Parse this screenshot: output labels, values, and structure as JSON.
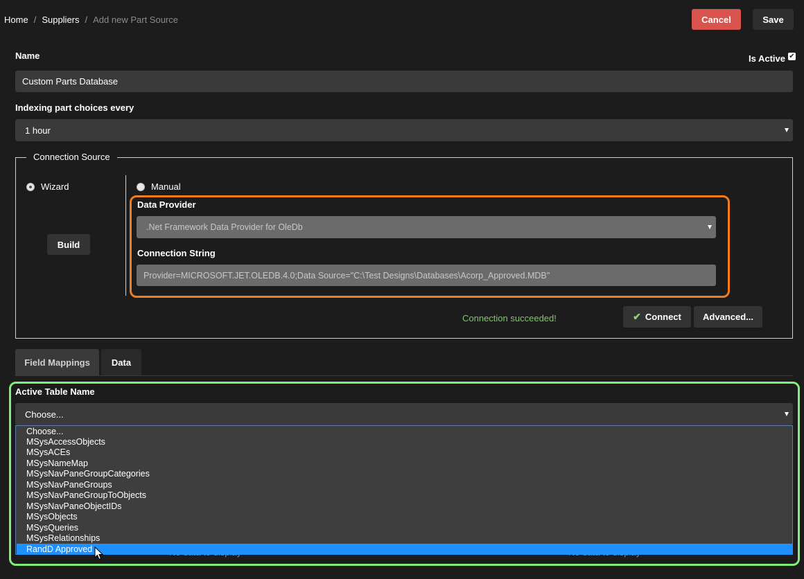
{
  "breadcrumb": {
    "home": "Home",
    "suppliers": "Suppliers",
    "separator": "/",
    "current": "Add new Part Source"
  },
  "header": {
    "cancel_label": "Cancel",
    "save_label": "Save"
  },
  "name": {
    "label": "Name",
    "value": "Custom Parts Database",
    "is_active_label": "Is Active",
    "is_active": true
  },
  "indexing": {
    "label": "Indexing part choices every",
    "value": "1 hour"
  },
  "connection": {
    "legend": "Connection Source",
    "wizard_label": "Wizard",
    "manual_label": "Manual",
    "selected_mode": "Wizard",
    "build_label": "Build",
    "provider_label": "Data Provider",
    "provider_value": ".Net Framework Data Provider for OleDb",
    "string_label": "Connection String",
    "string_value": "Provider=MICROSOFT.JET.OLEDB.4.0;Data Source=\"C:\\Test Designs\\Databases\\Acorp_Approved.MDB\"",
    "status": "Connection succeeded!",
    "connect_label": "Connect",
    "advanced_label": "Advanced..."
  },
  "tabs": [
    {
      "label": "Field Mappings"
    },
    {
      "label": "Data"
    }
  ],
  "table": {
    "label": "Active Table Name",
    "value": "Choose...",
    "options": [
      "Choose...",
      "MSysAccessObjects",
      "MSysACEs",
      "MSysNameMap",
      "MSysNavPaneGroupCategories",
      "MSysNavPaneGroups",
      "MSysNavPaneGroupToObjects",
      "MSysNavPaneObjectIDs",
      "MSysObjects",
      "MSysQueries",
      "MSysRelationships",
      "RandD Approved"
    ],
    "highlighted_option": "RandD Approved",
    "no_data_text": "No data to display"
  },
  "colors": {
    "background": "#1c1c1c",
    "cancel": "#d9534f",
    "highlight_orange": "#f07c21",
    "highlight_green": "#7ef07a",
    "success": "#7ec86a",
    "selection": "#1e90ff"
  }
}
